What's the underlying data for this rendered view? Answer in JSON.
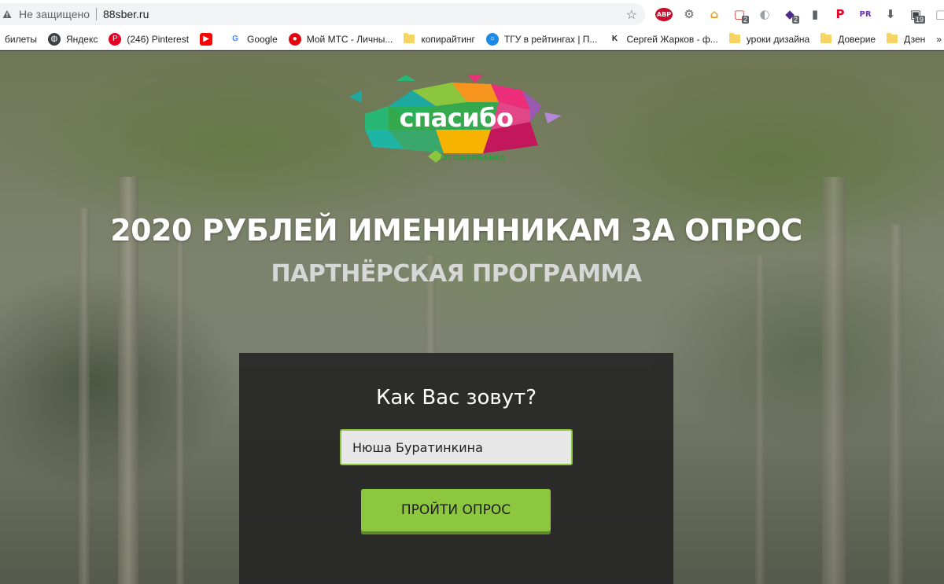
{
  "browser": {
    "security_label": "Не защищено",
    "url": "88sber.ru",
    "extensions": [
      {
        "name": "adblock-plus-icon",
        "glyph": "ABP",
        "color": "#c70d2c",
        "badge": ""
      },
      {
        "name": "extension-grid-icon",
        "glyph": "⚙",
        "color": "#5f6368",
        "badge": ""
      },
      {
        "name": "home-icon",
        "glyph": "⌂",
        "color": "#e8a02e",
        "badge": ""
      },
      {
        "name": "extension-red-icon",
        "glyph": "▢",
        "color": "#d93025",
        "badge": "2"
      },
      {
        "name": "moon-icon",
        "glyph": "◐",
        "color": "#9aa0a6",
        "badge": ""
      },
      {
        "name": "extension-purple-icon",
        "glyph": "◆",
        "color": "#4b2a8c",
        "badge": "2"
      },
      {
        "name": "bar-chart-icon",
        "glyph": "▮",
        "color": "#5f6368",
        "badge": ""
      },
      {
        "name": "pinterest-icon",
        "glyph": "P",
        "color": "#e60023",
        "badge": ""
      },
      {
        "name": "pr-icon",
        "glyph": "PR",
        "color": "#6b2fb3",
        "badge": ""
      },
      {
        "name": "download-icon",
        "glyph": "⬇",
        "color": "#5f6368",
        "badge": ""
      },
      {
        "name": "extension-dark-icon",
        "glyph": "▣",
        "color": "#3c4043",
        "badge": "19"
      },
      {
        "name": "extension-outline-icon",
        "glyph": "□",
        "color": "#9aa0a6",
        "badge": ""
      }
    ]
  },
  "bookmarks": [
    {
      "label": "билеты",
      "icon": "none"
    },
    {
      "label": "Яндекс",
      "icon": "globe"
    },
    {
      "label": "(246) Pinterest",
      "icon": "pinterest"
    },
    {
      "label": "",
      "icon": "youtube"
    },
    {
      "label": "Google",
      "icon": "google"
    },
    {
      "label": "Мой МТС - Личны...",
      "icon": "mts"
    },
    {
      "label": "копирайтинг",
      "icon": "folder"
    },
    {
      "label": "ТГУ в рейтингах | П...",
      "icon": "tgu"
    },
    {
      "label": "Сергей Жарков - ф...",
      "icon": "k"
    },
    {
      "label": "уроки дизайна",
      "icon": "folder"
    },
    {
      "label": "Доверие",
      "icon": "folder"
    },
    {
      "label": "Дзен",
      "icon": "folder"
    }
  ],
  "bookmarks_more": "»",
  "page": {
    "logo_text": "спасибо",
    "logo_sub": "ОТ СБЕРБАНКА",
    "headline": "2020 РУБЛЕЙ ИМЕНИННИКАМ ЗА ОПРОС",
    "subhead": "ПАРТНЁРСКАЯ ПРОГРАММА",
    "question": "Как Вас зовут?",
    "name_value": "Нюша Буратинкина",
    "button_label": "ПРОЙТИ ОПРОС"
  },
  "colors": {
    "accent_green": "#8dc63f",
    "card_bg": "#262626"
  }
}
